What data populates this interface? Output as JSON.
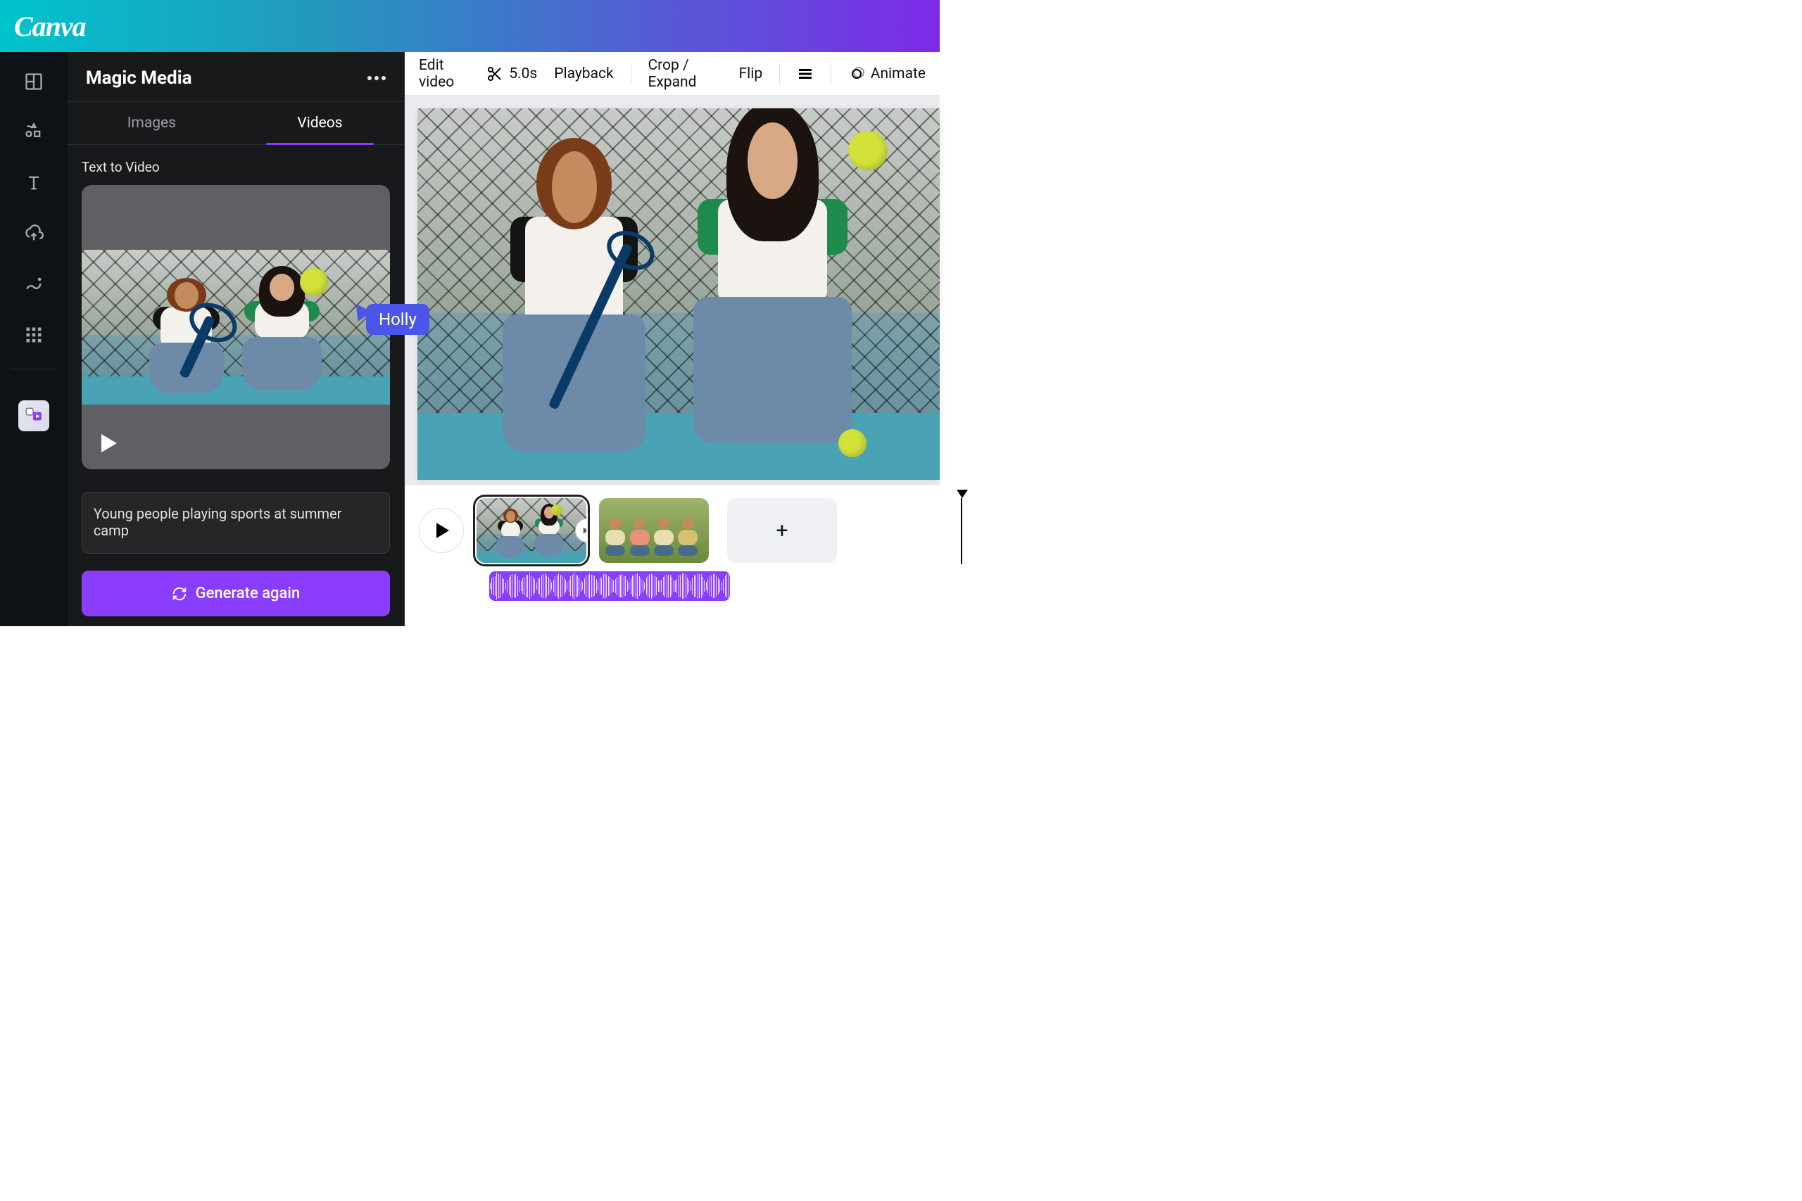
{
  "header": {
    "logo": "Canva"
  },
  "panel": {
    "title": "Magic Media",
    "tabs": {
      "images": "Images",
      "videos": "Videos"
    },
    "section_label": "Text to Video",
    "prompt_value": "Young people playing sports at summer camp",
    "generate_label": "Generate again"
  },
  "cursor": {
    "user": "Holly"
  },
  "toolbar": {
    "edit_video": "Edit video",
    "duration": "5.0s",
    "playback": "Playback",
    "crop_expand": "Crop / Expand",
    "flip": "Flip",
    "animate": "Animate"
  },
  "timeline": {
    "add_label": "+"
  }
}
